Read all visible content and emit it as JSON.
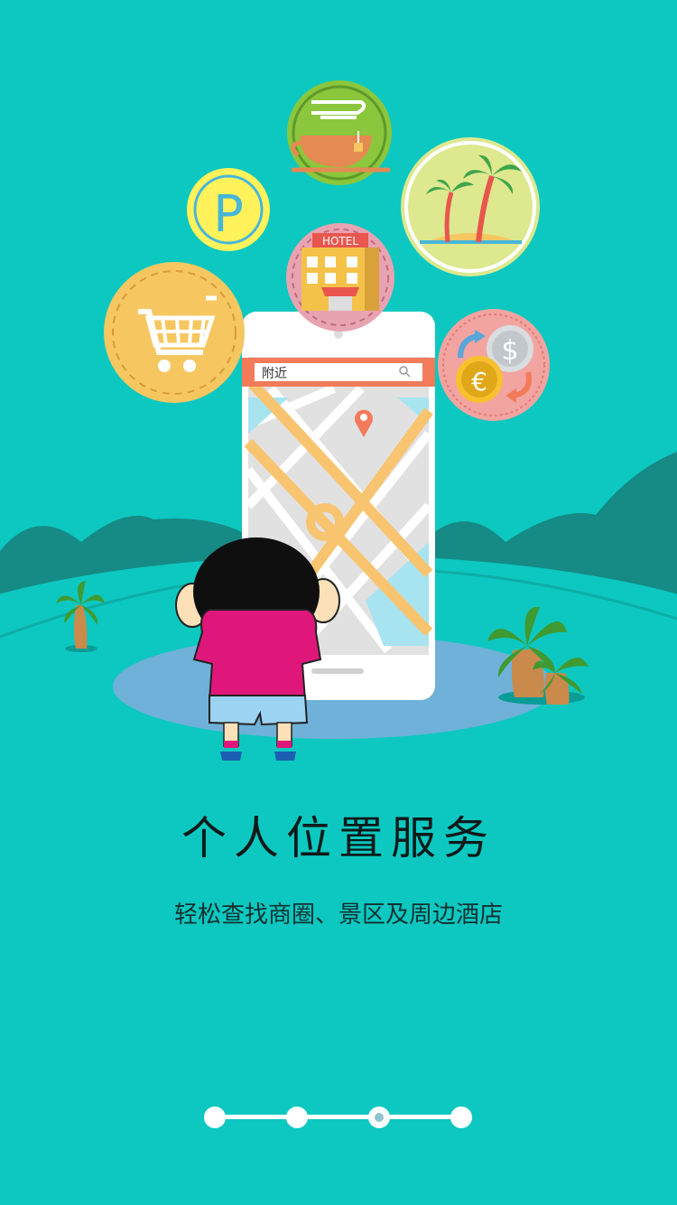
{
  "illustration": {
    "search_placeholder": "附近",
    "hotel_sign": "HOTEL",
    "parking_letter": "P",
    "dollar_symbol": "$",
    "euro_symbol": "€",
    "colors": {
      "background": "#0cc8c0",
      "hills": "#168a85",
      "ground": "#2fc0bc",
      "shadow_pond": "#6fb1d8",
      "map_bar": "#f37b5a",
      "road": "#f8c470"
    }
  },
  "headline": "个人位置服务",
  "subtitle": "轻松查找商圈、景区及周边酒店",
  "pager": {
    "count": 4,
    "active_index": 2
  }
}
